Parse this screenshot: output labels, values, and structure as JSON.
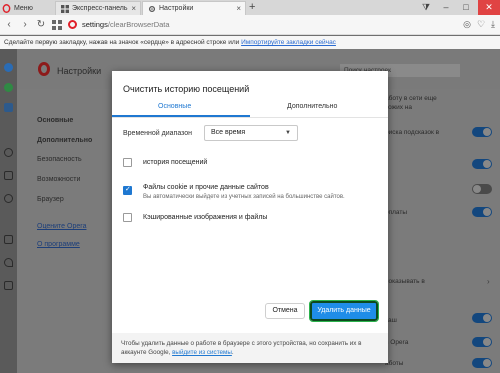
{
  "tabs": {
    "menu": "Меню",
    "express": "Экспресс-панель",
    "settings": "Настройки"
  },
  "address": {
    "host": "settings",
    "path": "/clearBrowserData"
  },
  "bookmark_hint": {
    "text": "Сделайте первую закладку, нажав на значок «сердце» в адресной строке или",
    "link": "Импортируйте закладки сейчас"
  },
  "settings_page": {
    "title": "Настройки",
    "search_placeholder": "Поиск настроек",
    "nav": {
      "basic": "Основные",
      "advanced": "Дополнительно",
      "security": "Безопасность",
      "features": "Возможности",
      "browser": "Браузер",
      "rate": "Оцените Opera",
      "about": "О программе"
    },
    "right_snippets": [
      "аботу в сети еще",
      "хожих на",
      "риска подсказок в",
      "оплаты",
      "показывать в",
      "каш",
      "в Opera",
      "аботы"
    ]
  },
  "dialog": {
    "title": "Очистить историю посещений",
    "tab_basic": "Основные",
    "tab_advanced": "Дополнительно",
    "range_label": "Временной диапазон",
    "range_value": "Все время",
    "options": [
      {
        "label": "история посещений",
        "checked": false
      },
      {
        "label": "Файлы cookie и прочие данные сайтов",
        "sub": "Вы автоматически выйдете из учетных записей на большинстве сайтов.",
        "checked": true
      },
      {
        "label": "Кэшированные изображения и файлы",
        "checked": false
      }
    ],
    "cancel_label": "Отмена",
    "delete_label": "Удалить данные",
    "footer_text": "Чтобы удалить данные о работе в браузере с этого устройства, но сохранить их в аккаунте Google,",
    "footer_link": "выйдите из системы"
  },
  "colors": {
    "accent": "#1f78d1",
    "brand": "#e0202a"
  }
}
